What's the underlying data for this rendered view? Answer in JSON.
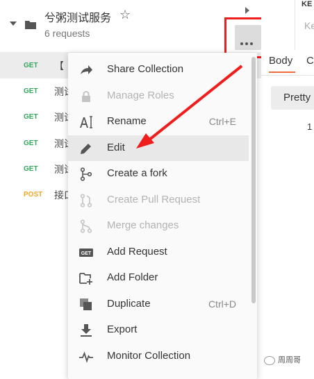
{
  "collection": {
    "title": "兮粥测试服务",
    "subtitle": "6 requests"
  },
  "requests": [
    {
      "method": "GET",
      "name": "【",
      "active": true
    },
    {
      "method": "GET",
      "name": "测试",
      "active": false
    },
    {
      "method": "GET",
      "name": "测试",
      "active": false
    },
    {
      "method": "GET",
      "name": "测试",
      "active": false
    },
    {
      "method": "GET",
      "name": "测试",
      "active": false
    },
    {
      "method": "POST",
      "name": "接口",
      "active": false
    }
  ],
  "right_pane": {
    "key_header": "KE",
    "key_placeholder": "Ke",
    "tab_body": "Body",
    "tab_second": "C",
    "pretty_label": "Pretty",
    "line_number": "1"
  },
  "menu": {
    "items": [
      {
        "label": "Share Collection",
        "icon": "share-icon",
        "shortcut": "",
        "disabled": false
      },
      {
        "label": "Manage Roles",
        "icon": "lock-icon",
        "shortcut": "",
        "disabled": true
      },
      {
        "label": "Rename",
        "icon": "rename-icon",
        "shortcut": "Ctrl+E",
        "disabled": false
      },
      {
        "label": "Edit",
        "icon": "pencil-icon",
        "shortcut": "",
        "disabled": false,
        "hover": true
      },
      {
        "label": "Create a fork",
        "icon": "fork-icon",
        "shortcut": "",
        "disabled": false
      },
      {
        "label": "Create Pull Request",
        "icon": "pull-request-icon",
        "shortcut": "",
        "disabled": true
      },
      {
        "label": "Merge changes",
        "icon": "merge-icon",
        "shortcut": "",
        "disabled": true
      },
      {
        "label": "Add Request",
        "icon": "get-request-icon",
        "shortcut": "",
        "disabled": false
      },
      {
        "label": "Add Folder",
        "icon": "add-folder-icon",
        "shortcut": "",
        "disabled": false
      },
      {
        "label": "Duplicate",
        "icon": "duplicate-icon",
        "shortcut": "Ctrl+D",
        "disabled": false
      },
      {
        "label": "Export",
        "icon": "export-icon",
        "shortcut": "",
        "disabled": false
      },
      {
        "label": "Monitor Collection",
        "icon": "monitor-icon",
        "shortcut": "",
        "disabled": false
      }
    ],
    "get_badge_text": "GET"
  },
  "watermark": "周周哥",
  "colors": {
    "get": "#33a55d",
    "post": "#f5a623",
    "annotation_red": "#f01d1d",
    "tab_accent": "#f26b3a"
  }
}
